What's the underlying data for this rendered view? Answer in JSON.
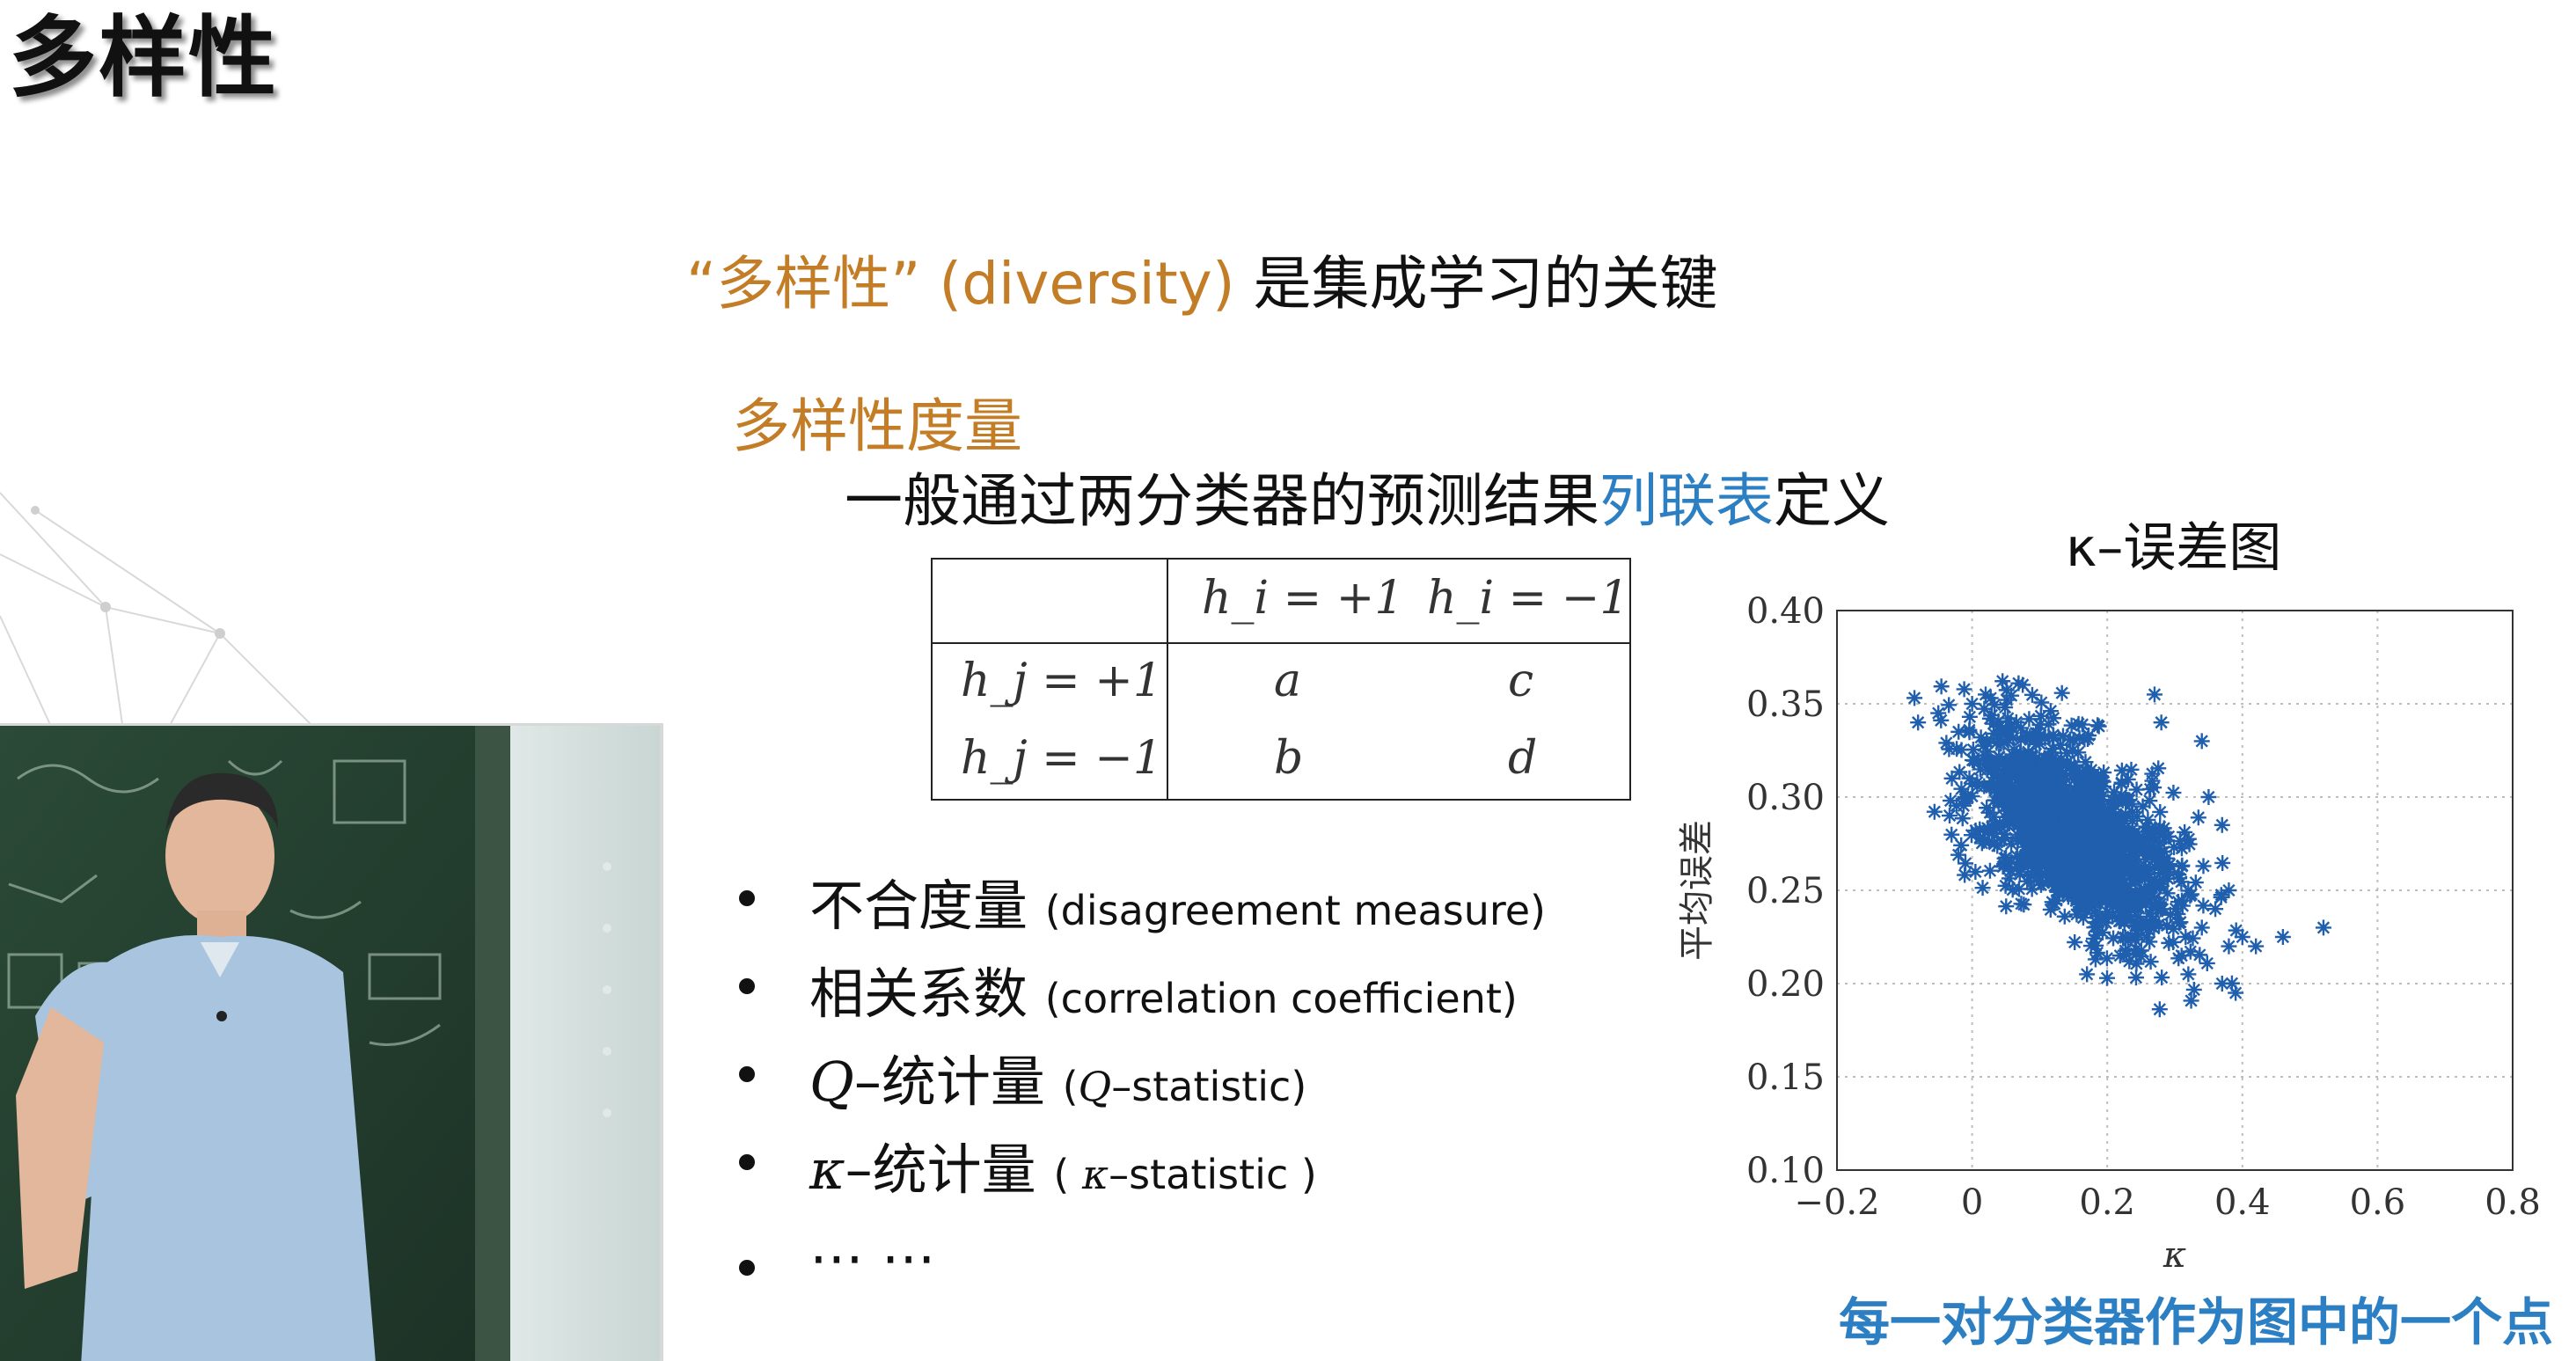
{
  "slide": {
    "title": "多样性",
    "headline": {
      "quoted_term": "“多样性”",
      "english": "(diversity)",
      "rest": "是集成学习的关键"
    },
    "subheading": "多样性度量",
    "definition": {
      "before": "一般通过两分类器的预测结果",
      "highlight": "列联表",
      "after": "定义"
    }
  },
  "contingency_table": {
    "col_headers": [
      "h_i = +1",
      "h_i = −1"
    ],
    "rows": [
      {
        "label": "h_j = +1",
        "cells": [
          "a",
          "c"
        ]
      },
      {
        "label": "h_j = −1",
        "cells": [
          "b",
          "d"
        ]
      }
    ]
  },
  "measures": [
    {
      "cn": "不合度量",
      "en": "(disagreement measure)"
    },
    {
      "cn": "相关系数",
      "en": "(correlation coefficient)"
    },
    {
      "sym": "Q",
      "cn": "–统计量",
      "en_sym": "Q",
      "en": "–statistic)"
    },
    {
      "sym": "κ",
      "cn": "–统计量",
      "en_sym": "κ",
      "en": "–statistic )"
    },
    {
      "cn": "⋯ ⋯",
      "en": ""
    }
  ],
  "chart_data": {
    "type": "scatter",
    "title": "κ–误差图",
    "xlabel": "κ",
    "ylabel": "平均误差",
    "xlim": [
      -0.2,
      0.8
    ],
    "ylim": [
      0.1,
      0.4
    ],
    "xticks": [
      "−0.2",
      "0",
      "0.2",
      "0.4",
      "0.6",
      "0.8"
    ],
    "yticks": [
      "0.10",
      "0.15",
      "0.20",
      "0.25",
      "0.30",
      "0.35",
      "0.40"
    ],
    "grid": true,
    "marker": "asterisk",
    "color": "#1f5fae",
    "cluster": {
      "center": [
        0.15,
        0.28
      ],
      "spread_x": 0.075,
      "spread_y": 0.028,
      "points": 1500
    },
    "outliers": [
      [
        -0.08,
        0.34
      ],
      [
        -0.05,
        0.345
      ],
      [
        -0.02,
        0.335
      ],
      [
        -0.03,
        0.31
      ],
      [
        -0.01,
        0.3
      ],
      [
        0.0,
        0.35
      ],
      [
        0.02,
        0.355
      ],
      [
        0.27,
        0.355
      ],
      [
        0.28,
        0.34
      ],
      [
        0.34,
        0.33
      ],
      [
        0.35,
        0.3
      ],
      [
        0.37,
        0.285
      ],
      [
        0.36,
        0.24
      ],
      [
        0.38,
        0.25
      ],
      [
        0.34,
        0.23
      ],
      [
        0.38,
        0.22
      ],
      [
        0.4,
        0.225
      ],
      [
        0.42,
        0.22
      ],
      [
        0.46,
        0.225
      ],
      [
        0.52,
        0.23
      ],
      [
        0.37,
        0.2
      ],
      [
        0.39,
        0.195
      ],
      [
        0.17,
        0.205
      ],
      [
        0.31,
        0.215
      ],
      [
        0.32,
        0.205
      ]
    ],
    "caption": "每一对分类器作为图中的一个点"
  },
  "colors": {
    "accent_orange": "#c47d27",
    "accent_blue": "#2c7fc2",
    "marker_blue": "#1f5fae"
  }
}
